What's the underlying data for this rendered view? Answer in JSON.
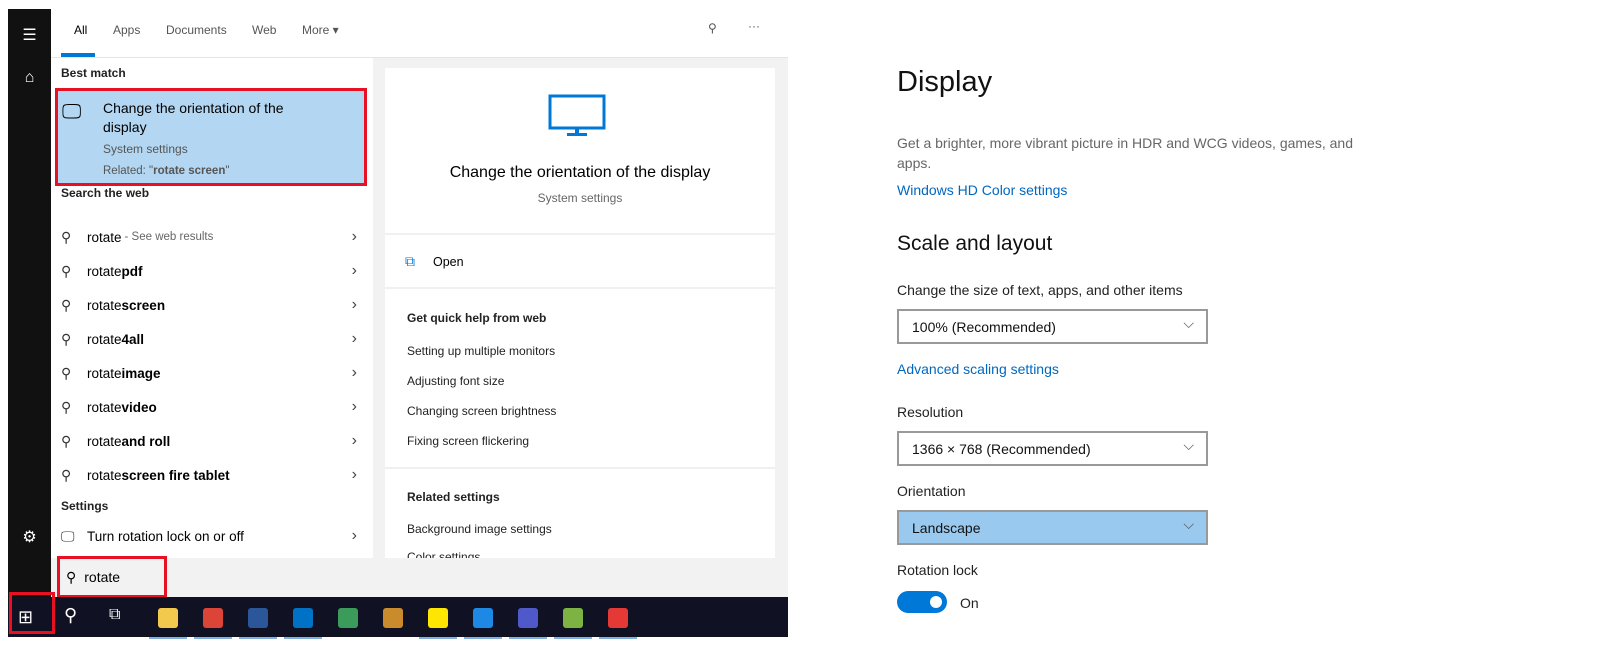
{
  "search": {
    "tabs": [
      "All",
      "Apps",
      "Documents",
      "Web",
      "More ▾"
    ],
    "best_match_label": "Best match",
    "best_match": {
      "title": "Change the orientation of the display",
      "subtitle": "System settings",
      "related_prefix": "Related: \"",
      "related_bold": "rotate screen",
      "related_suffix": "\""
    },
    "web_label": "Search the web",
    "web_results": [
      {
        "q": "rotate",
        "b": "",
        "hint": "- See web results"
      },
      {
        "q": "rotate",
        "b": " pdf",
        "hint": ""
      },
      {
        "q": "rotate",
        "b": " screen",
        "hint": ""
      },
      {
        "q": "rotate",
        "b": "4all",
        "hint": ""
      },
      {
        "q": "rotate",
        "b": " image",
        "hint": ""
      },
      {
        "q": "rotate",
        "b": " video",
        "hint": ""
      },
      {
        "q": "rotate",
        "b": " and roll",
        "hint": ""
      },
      {
        "q": "rotate",
        "b": " screen fire tablet",
        "hint": ""
      }
    ],
    "settings_label": "Settings",
    "settings_item": "Turn rotation lock on or off",
    "query": "rotate",
    "preview": {
      "title": "Change the orientation of the display",
      "subtitle": "System settings",
      "open": "Open",
      "help_label": "Get quick help from web",
      "help_links": [
        "Setting up multiple monitors",
        "Adjusting font size",
        "Changing screen brightness",
        "Fixing screen flickering"
      ],
      "related_label": "Related settings",
      "related_links": [
        "Background image settings",
        "Color settings"
      ]
    }
  },
  "taskbar": {
    "apps": [
      "File Explorer",
      "Chrome",
      "Word",
      "Outlook",
      "Edge",
      "App",
      "Sticky Notes",
      "Photos",
      "Teams",
      "Paint",
      "Snipping Tool"
    ]
  },
  "display": {
    "title": "Display",
    "hdr_text": "Get a brighter, more vibrant picture in HDR and WCG videos, games, and apps.",
    "hdr_link": "Windows HD Color settings",
    "scale_heading": "Scale and layout",
    "scale_label": "Change the size of text, apps, and other items",
    "scale_value": "100% (Recommended)",
    "adv_link": "Advanced scaling settings",
    "res_label": "Resolution",
    "res_value": "1366 × 768 (Recommended)",
    "orient_label": "Orientation",
    "orient_value": "Landscape",
    "lock_label": "Rotation lock",
    "lock_state": "On"
  },
  "colors": {
    "accent": "#0078d7",
    "highlight": "#b3d7f2",
    "annotation": "#e81123"
  }
}
